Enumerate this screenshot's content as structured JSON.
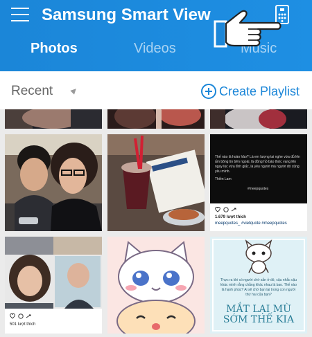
{
  "header": {
    "title": "Samsung Smart View",
    "menu_icon": "hamburger-icon",
    "remote_icon": "tv-remote-icon",
    "color": "#1b86d8"
  },
  "tabs": [
    {
      "label": "Photos",
      "active": true
    },
    {
      "label": "Videos",
      "active": false
    },
    {
      "label": "Music",
      "active": false
    }
  ],
  "toolbar": {
    "sort_label": "Recent",
    "create_playlist_label": "Create Playlist"
  },
  "tiles": {
    "quote_card": {
      "text": "Thế nào là hoàn hảo? Là em lượng tai nghe vừa đủ lên ấm bông tin bên ngoài, là đồng hồ báo thức vang lên ngay lúc vừa tỉnh giấc, là yêu người mà người đó cũng yêu mình.",
      "author": "Thiền Lam",
      "hashtag": "#meepquotes",
      "likes": "1.679 lượt thích",
      "tags": "meepquotes_ #vietquote #meepquotes"
    },
    "collage_post": {
      "likes": "501 lượt thích"
    },
    "poster": {
      "text": "Thực ra khi có người chờ sẵn ở đó, cậu nhắc cậu khác mình rằng chẳng khác nhau là bao. Thế nào là hạnh phúc? Ai sẽ chờ bạn lại trong con người thứ hai của bạn?",
      "title": "MẮT LẠI MÙ SỚM THẾ KIA"
    }
  }
}
